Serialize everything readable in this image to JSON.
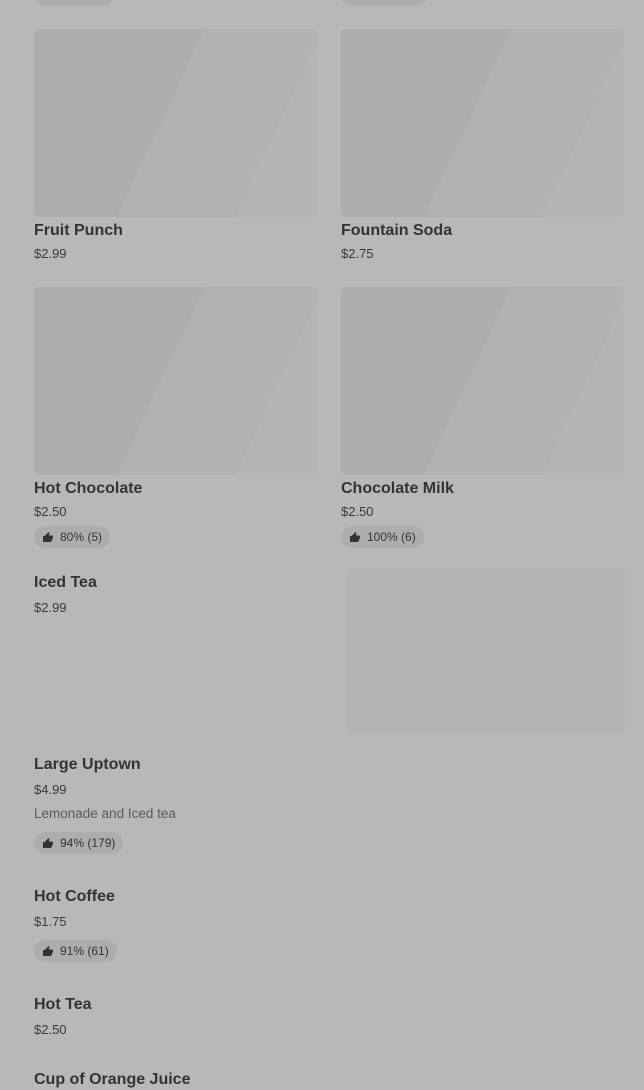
{
  "items": [
    {
      "name": " Fruit Punch",
      "price": "$2.99"
    },
    {
      "name": "Fountain Soda",
      "price": "$2.75"
    },
    {
      "name": "Hot Chocolate",
      "price": "$2.50",
      "rating": "80% (5)"
    },
    {
      "name": "Chocolate Milk",
      "price": "$2.50",
      "rating": "100% (6)"
    },
    {
      "name": "Iced Tea",
      "price": "$2.99"
    },
    {
      "name": "Large Uptown",
      "price": "$4.99",
      "description": "Lemonade and Iced tea",
      "rating": "94% (179)"
    },
    {
      "name": "Hot Coffee",
      "price": "$1.75",
      "rating": "91% (61)"
    },
    {
      "name": "Hot Tea",
      "price": "$2.50"
    },
    {
      "name": "Cup of Orange Juice"
    }
  ],
  "icons": {
    "rating": "thumbs-up-icon"
  }
}
